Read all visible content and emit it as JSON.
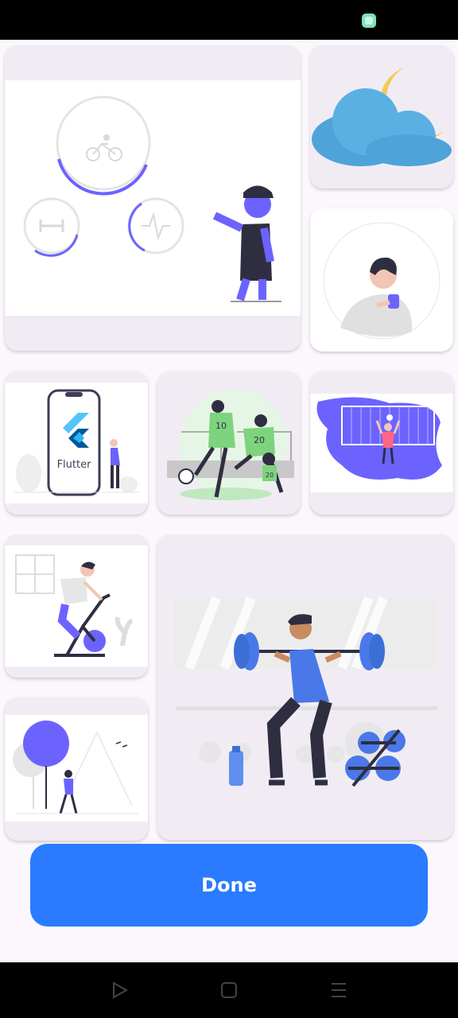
{
  "status_bar": {
    "icons": [
      "notification-app-icon"
    ]
  },
  "gallery": {
    "cards": [
      {
        "name": "fitness-tracker-illustration",
        "icon": "bicycle-icon"
      },
      {
        "name": "weather-cloud-moon-illustration",
        "icon": "cloud-moon-icon"
      },
      {
        "name": "person-drinking-coffee-illustration",
        "icon": "person-mug-icon"
      },
      {
        "name": "flutter-phone-illustration",
        "label": "Flutter"
      },
      {
        "name": "soccer-players-illustration",
        "jersey_numbers": [
          "10",
          "20",
          "20"
        ]
      },
      {
        "name": "goalkeeper-illustration"
      },
      {
        "name": "exercise-bike-illustration"
      },
      {
        "name": "weightlifting-squat-illustration"
      },
      {
        "name": "hiker-in-nature-illustration"
      }
    ]
  },
  "done_button": {
    "label": "Done"
  },
  "nav_bar": {
    "buttons": [
      "back-icon",
      "home-icon",
      "menu-icon"
    ]
  },
  "colors": {
    "accent": "#2a7bff",
    "illustration_purple": "#6c63ff",
    "card_bg": "#f1ecf4",
    "page_bg": "#fbf7fc"
  }
}
